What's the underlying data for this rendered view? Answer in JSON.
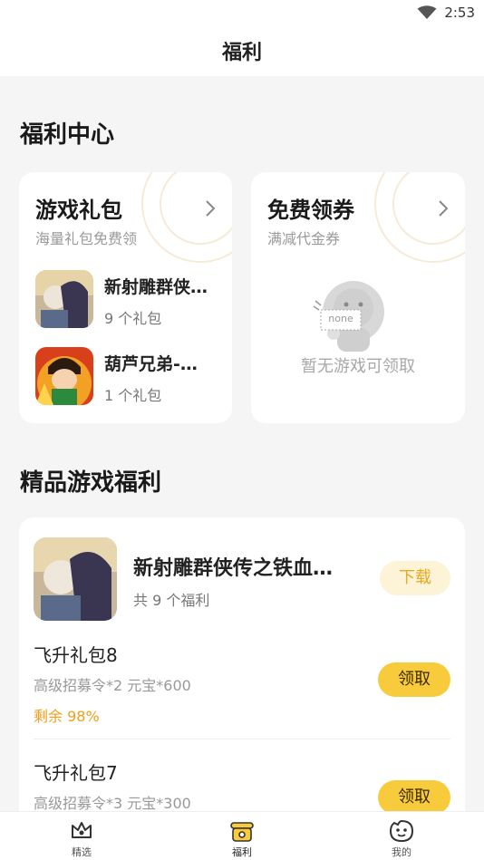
{
  "status_bar": {
    "time": "2:53",
    "wifi_icon": "wifi-icon"
  },
  "header": {
    "title": "福利"
  },
  "welfare_center": {
    "title": "福利中心",
    "gift_card": {
      "title": "游戏礼包",
      "subtitle": "海量礼包免费领",
      "items": [
        {
          "name": "新射雕群侠…",
          "count": "9 个礼包"
        },
        {
          "name": "葫芦兄弟-…",
          "count": "1 个礼包"
        }
      ]
    },
    "coupon_card": {
      "title": "免费领券",
      "subtitle": "满减代金券",
      "empty_badge": "none",
      "empty_text": "暂无游戏可领取"
    }
  },
  "premium": {
    "title": "精品游戏福利",
    "game": {
      "name": "新射雕群侠传之铁血…",
      "count": "共 9 个福利",
      "download_label": "下载"
    },
    "gifts": [
      {
        "name": "飞升礼包8",
        "desc": "高级招募令*2 元宝*600",
        "remain": "剩余 98%",
        "claim_label": "领取"
      },
      {
        "name": "飞升礼包7",
        "desc": "高级招募令*3 元宝*300",
        "claim_label": "领取"
      }
    ]
  },
  "bottom_nav": [
    {
      "label": "精选",
      "icon": "crown-icon",
      "active": false
    },
    {
      "label": "福利",
      "icon": "gift-bag-icon",
      "active": true
    },
    {
      "label": "我的",
      "icon": "smile-face-icon",
      "active": false
    }
  ],
  "colors": {
    "accent": "#f8cb3c",
    "remain": "#f0a01c",
    "download_bg": "#fdf3d6"
  }
}
